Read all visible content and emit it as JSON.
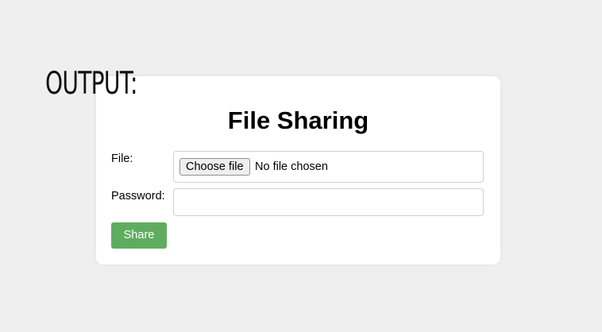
{
  "overlay": {
    "output_label": "OUTPUT:"
  },
  "form": {
    "title": "File Sharing",
    "file_label": "File:",
    "choose_button": "Choose file",
    "file_status": "No file chosen",
    "password_label": "Password:",
    "password_value": "",
    "share_button": "Share"
  },
  "colors": {
    "page_background": "#efefef",
    "card_background": "#ffffff",
    "share_button": "#5fac5f"
  }
}
